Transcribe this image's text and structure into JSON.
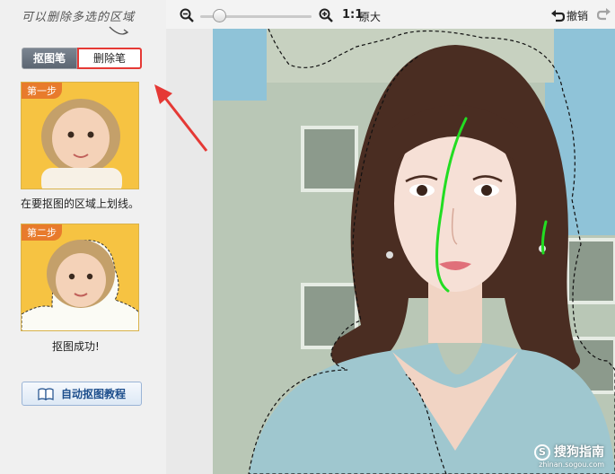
{
  "left_panel": {
    "hint": "可以删除多选的区域",
    "tools": {
      "cutout_pen": "抠图笔",
      "eraser_pen": "删除笔"
    },
    "steps": [
      {
        "badge": "第一步",
        "caption": "在要抠图的区域上划线。"
      },
      {
        "badge": "第二步",
        "caption": "抠图成功!"
      }
    ],
    "tutorial_button": "自动抠图教程"
  },
  "toolbar": {
    "ratio": "1:1",
    "original_size": "原大",
    "undo": "撤销",
    "zoom_level_fraction": 0.13
  },
  "watermark": {
    "main": "搜狗指南",
    "sub": "zhinan.sogou.com"
  },
  "colors": {
    "accent_red": "#e53935",
    "stroke_green": "#22dd22",
    "sky": "#8fc3d8"
  }
}
